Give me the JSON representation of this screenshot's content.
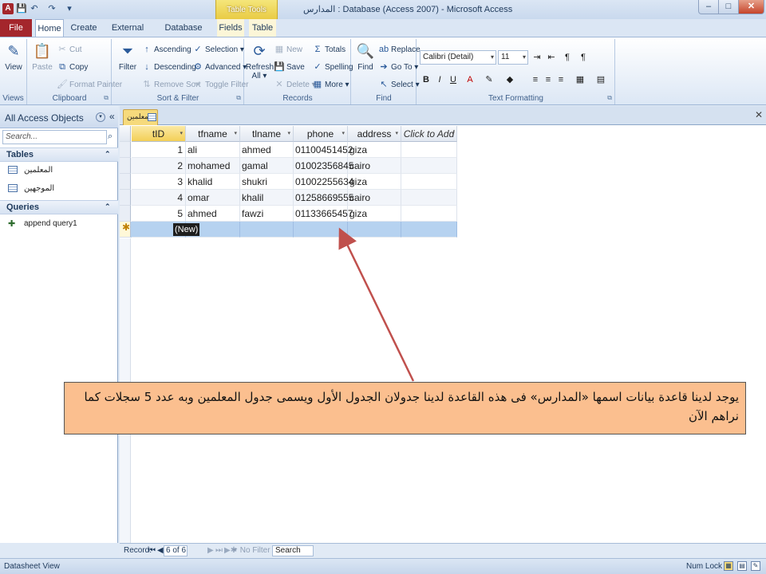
{
  "window": {
    "title": "المدارس : Database (Access 2007)  -  Microsoft Access",
    "app_icon": "A",
    "controls": {
      "minimize": "–",
      "maximize": "□",
      "close": "✕"
    }
  },
  "ribbon": {
    "contextual_header": "Table Tools",
    "tabs": [
      "File",
      "Home",
      "Create",
      "External Data",
      "Database Tools",
      "Fields",
      "Table"
    ],
    "views_group": {
      "label": "Views",
      "view_button": "View"
    },
    "clipboard": {
      "label": "Clipboard",
      "paste": "Paste",
      "cut": "Cut",
      "copy": "Copy",
      "format_painter": "Format Painter"
    },
    "sort_filter": {
      "label": "Sort & Filter",
      "filter": "Filter",
      "ascending": "Ascending",
      "descending": "Descending",
      "remove_sort": "Remove Sort",
      "selection": "Selection ▾",
      "advanced": "Advanced ▾",
      "toggle_filter": "Toggle Filter"
    },
    "records": {
      "label": "Records",
      "refresh": "Refresh All ▾",
      "new": "New",
      "save": "Save",
      "delete": "Delete ▾",
      "totals": "Totals",
      "spelling": "Spelling",
      "more": "More ▾"
    },
    "find_group": {
      "label": "Find",
      "find": "Find",
      "replace": "Replace",
      "goto": "Go To ▾",
      "select": "Select ▾"
    },
    "text_formatting": {
      "label": "Text Formatting",
      "font": "Calibri (Detail)",
      "size": "11",
      "bold": "B",
      "italic": "I",
      "underline": "U"
    }
  },
  "nav_pane": {
    "title": "All Access Objects",
    "search_placeholder": "Search...",
    "sections": [
      {
        "name": "Tables",
        "items": [
          "المعلمين",
          "الموجهين"
        ]
      },
      {
        "name": "Queries",
        "items": [
          "append query1"
        ]
      }
    ]
  },
  "document": {
    "tab_label": "المعلمين",
    "columns": [
      "tID",
      "tfname",
      "tlname",
      "phone",
      "address",
      "Click to Add"
    ],
    "rows": [
      [
        "1",
        "ali",
        "ahmed",
        "01100451452",
        "giza"
      ],
      [
        "2",
        "mohamed",
        "gamal",
        "01002356845",
        "cairo"
      ],
      [
        "3",
        "khalid",
        "shukri",
        "01002255634",
        "giza"
      ],
      [
        "4",
        "omar",
        "khalil",
        "01258669555",
        "cairo"
      ],
      [
        "5",
        "ahmed",
        "fawzi",
        "01133665457",
        "giza"
      ]
    ],
    "new_row_marker": "(New)",
    "new_row_star": "✱"
  },
  "record_nav": {
    "label": "Record:",
    "position": "6 of 6",
    "no_filter": "No Filter",
    "search": "Search"
  },
  "status_bar": {
    "left": "Datasheet View",
    "num_lock": "Num Lock"
  },
  "annotation": {
    "text": "يوجد لدينا قاعدة بيانات اسمها «المدارس» فى هذه القاعدة لدينا جدولان الجدول الأول ويسمى جدول المعلمين وبه عدد 5 سجلات كما نراهم الآن",
    "background": "#fbbf8f",
    "arrow_color": "#c0504d"
  },
  "colors": {
    "file_tab": "#a4262c",
    "selected_row": "#b6d2f0",
    "contextual_tab": "#f5e67a"
  }
}
